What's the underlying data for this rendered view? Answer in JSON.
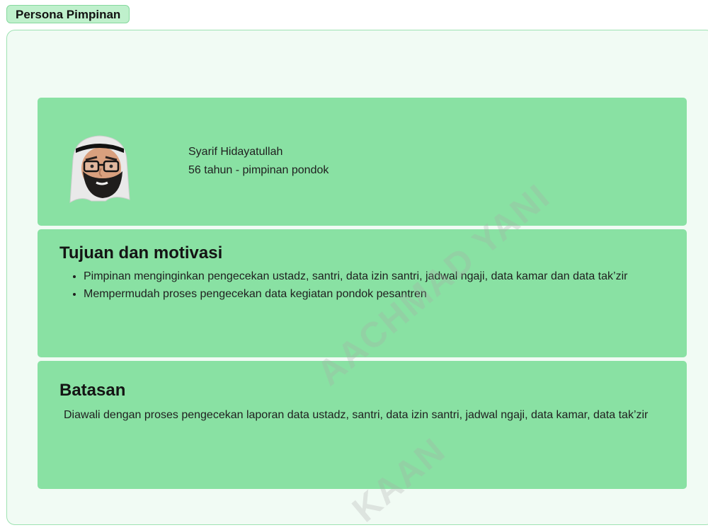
{
  "frame": {
    "label": "Persona Pimpinan"
  },
  "profile": {
    "name": "Syarif Hidayatullah",
    "meta": "56 tahun - pimpinan pondok",
    "avatar_icon": "avatar-memoji-keffiyeh-icon"
  },
  "goals": {
    "heading": "Tujuan dan motivasi",
    "items": [
      "Pimpinan menginginkan pengecekan ustadz, santri, data izin santri, jadwal ngaji, data kamar dan data tak’zir",
      "Mempermudah proses pengecekan data kegiatan pondok pesantren"
    ]
  },
  "limits": {
    "heading": "Batasan",
    "text": "Diawali dengan proses pengecekan laporan data ustadz, santri, data izin santri, jadwal ngaji, data kamar, data tak’zir"
  },
  "watermark": {
    "line1": "AACHMAD YANI",
    "line2": "KAAN"
  },
  "colors": {
    "card": "#89e1a3",
    "frame_bg": "#f1fbf4",
    "frame_border": "#9ee2b2",
    "label_bg": "#bff0cc"
  }
}
